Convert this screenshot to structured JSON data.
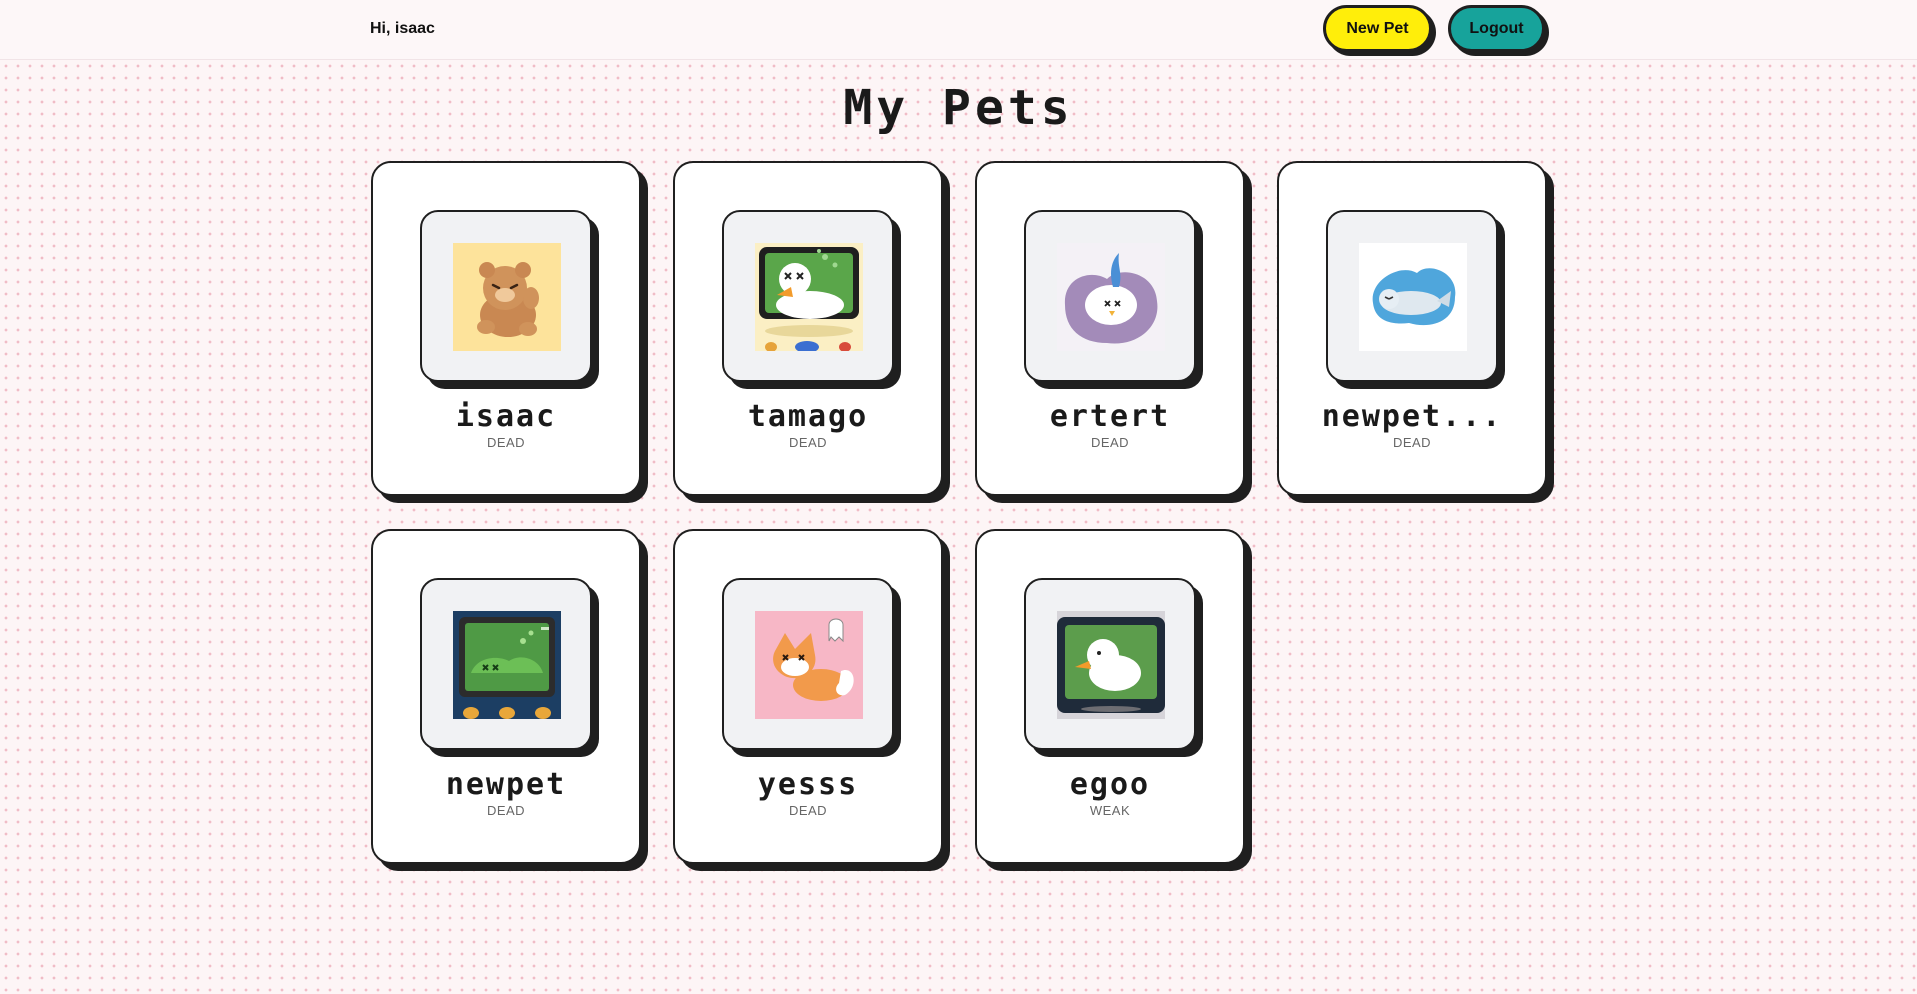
{
  "header": {
    "greeting": "Hi, isaac",
    "new_pet_label": "New Pet",
    "logout_label": "Logout"
  },
  "page_title": "My Pets",
  "colors": {
    "new_pet_button": "#ffee0a",
    "logout_button": "#17a39b",
    "page_background": "#fdf5f6"
  },
  "pets": [
    {
      "name": "isaac",
      "status": "DEAD",
      "image": "sleeping-bear"
    },
    {
      "name": "tamago",
      "status": "DEAD",
      "image": "dead-duck-on-screen"
    },
    {
      "name": "ertert",
      "status": "DEAD",
      "image": "dead-bird-purple-cloud"
    },
    {
      "name": "newpet...",
      "status": "DEAD",
      "image": "seal"
    },
    {
      "name": "newpet",
      "status": "DEAD",
      "image": "dead-crocodile-on-screen"
    },
    {
      "name": "yesss",
      "status": "DEAD",
      "image": "dead-fox-with-ghost"
    },
    {
      "name": "egoo",
      "status": "WEAK",
      "image": "duck-on-screen"
    }
  ]
}
